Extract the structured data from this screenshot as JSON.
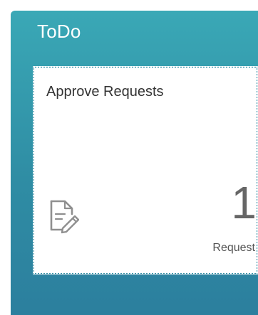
{
  "group": {
    "title": "ToDo"
  },
  "tile": {
    "title": "Approve Requests",
    "icon": "document-edit-icon",
    "count": "1",
    "unit": "Request"
  },
  "colors": {
    "panel_top": "#3aa8b6",
    "panel_bottom": "#2c7f9e",
    "tile_bg": "#ffffff",
    "icon": "#8f8f8f"
  }
}
